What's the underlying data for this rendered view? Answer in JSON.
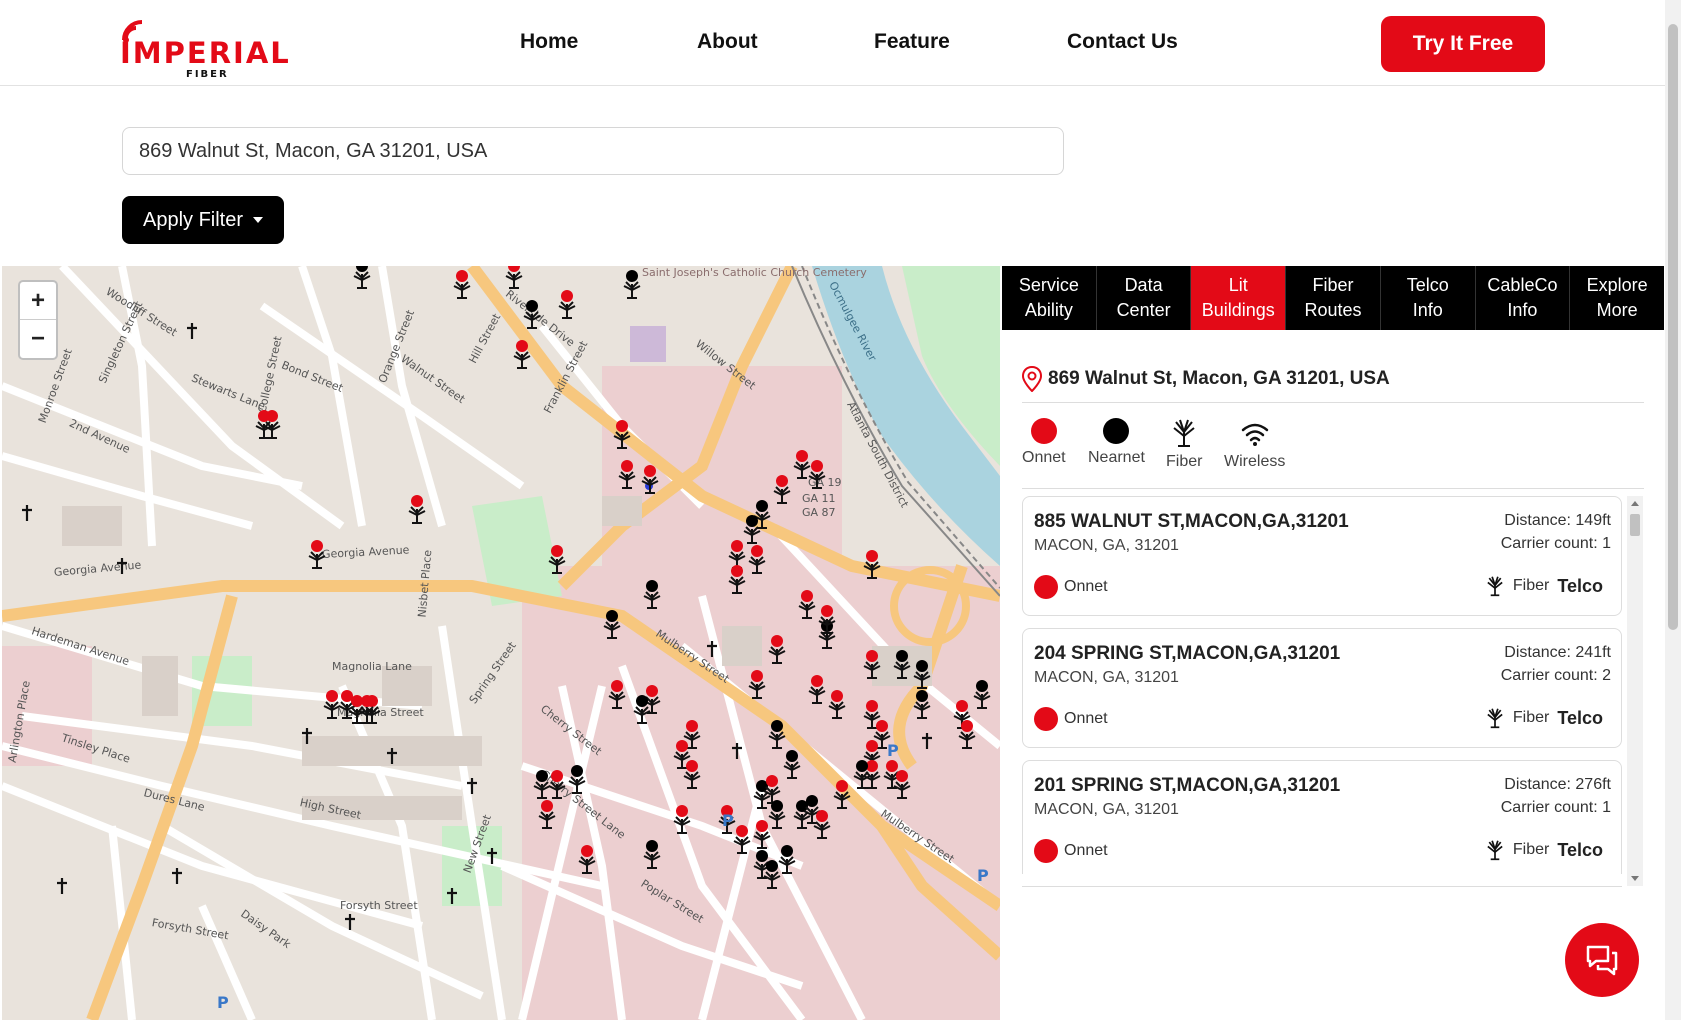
{
  "header": {
    "logo_word": "IMPERIAL",
    "logo_sub": "FIBER",
    "nav": [
      "Home",
      "About",
      "Feature",
      "Contact Us"
    ],
    "cta_label": "Try It Free",
    "brand_color": "#e30a17"
  },
  "search": {
    "value": "869 Walnut St, Macon, GA 31201, USA"
  },
  "filter": {
    "label": "Apply Filter"
  },
  "map": {
    "zoom_in": "+",
    "zoom_out": "−",
    "streets": [
      "Woodliff Street",
      "Monroe Street",
      "Singleton Street",
      "Stewarts Lane",
      "College Street",
      "Bond Street",
      "Orange Street",
      "Walnut Street",
      "Hill Street",
      "Franklin Street",
      "Riverside Drive",
      "Willow Street",
      "Georgia Avenue",
      "Magnolia Lane",
      "Magnolia Street",
      "Hardeman Avenue",
      "Tinsley Place",
      "Dures Lane",
      "High Street",
      "Forsyth Street",
      "Mulberry Street",
      "Cherry Street",
      "Poplar Street",
      "2nd Avenue",
      "Nisbet Place",
      "Spring Street",
      "Arlington Place",
      "Daisy Park",
      "Cherry Street Lane",
      "New Street"
    ],
    "poi_labels": [
      "Saint Joseph's Catholic Church Cemetery",
      "Ocmulgee River",
      "Atlanta South District",
      "GA 19",
      "GA 11",
      "GA 87"
    ]
  },
  "panel": {
    "tabs": [
      {
        "line1": "Service",
        "line2": "Ability"
      },
      {
        "line1": "Data",
        "line2": "Center"
      },
      {
        "line1": "Lit",
        "line2": "Buildings"
      },
      {
        "line1": "Fiber",
        "line2": "Routes"
      },
      {
        "line1": "Telco",
        "line2": "Info"
      },
      {
        "line1": "CableCo",
        "line2": "Info"
      },
      {
        "line1": "Explore",
        "line2": "More"
      }
    ],
    "active_tab_index": 2,
    "address": "869 Walnut St, Macon, GA 31201, USA",
    "legend": [
      {
        "label": "Onnet",
        "icon": "red-dot-icon",
        "color": "#e30a17"
      },
      {
        "label": "Nearnet",
        "icon": "black-dot-icon",
        "color": "#000000"
      },
      {
        "label": "Fiber",
        "icon": "fiber-icon"
      },
      {
        "label": "Wireless",
        "icon": "wifi-icon"
      }
    ],
    "cards": [
      {
        "title": "885 WALNUT ST,MACON,GA,31201",
        "sub": "MACON, GA, 31201",
        "distance": "Distance: 149ft",
        "carrier": "Carrier count: 1",
        "status": "Onnet",
        "fiber": "Fiber",
        "telco": "Telco"
      },
      {
        "title": "204 SPRING ST,MACON,GA,31201",
        "sub": "MACON, GA, 31201",
        "distance": "Distance: 241ft",
        "carrier": "Carrier count: 2",
        "status": "Onnet",
        "fiber": "Fiber",
        "telco": "Telco"
      },
      {
        "title": "201 SPRING ST,MACON,GA,31201",
        "sub": "MACON, GA, 31201",
        "distance": "Distance: 276ft",
        "carrier": "Carrier count: 1",
        "status": "Onnet",
        "fiber": "Fiber",
        "telco": "Telco"
      }
    ]
  }
}
